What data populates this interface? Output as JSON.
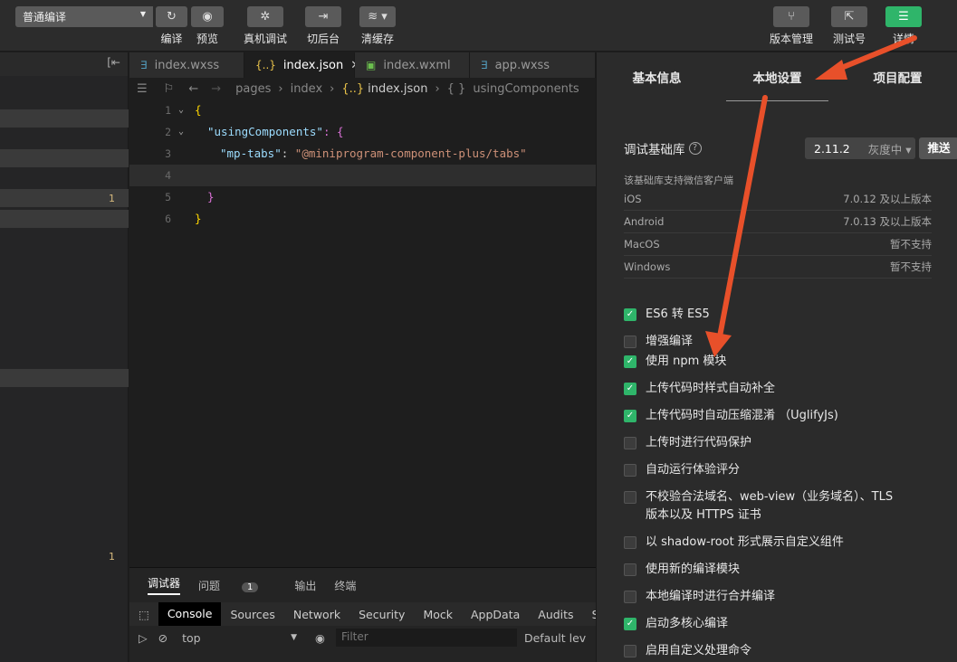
{
  "toolbar": {
    "compile_mode": "普通编译",
    "buttons": [
      {
        "label": "编译",
        "icon": "refresh-icon"
      },
      {
        "label": "预览",
        "icon": "eye-icon"
      },
      {
        "label": "真机调试",
        "icon": "bug-icon"
      },
      {
        "label": "切后台",
        "icon": "switch-icon"
      },
      {
        "label": "清缓存",
        "icon": "layers-icon"
      },
      {
        "label": "版本管理",
        "icon": "branch-icon"
      },
      {
        "label": "测试号",
        "icon": "share-icon"
      },
      {
        "label": "详情",
        "icon": "menu-icon"
      }
    ],
    "accent_color": "#2fb56a"
  },
  "left": {
    "numbers": [
      "1",
      "1"
    ]
  },
  "tabs": [
    {
      "label": "index.wxss",
      "icon": "css-icon"
    },
    {
      "label": "index.json",
      "icon": "json-icon",
      "active": true
    },
    {
      "label": "index.wxml",
      "icon": "wxml-icon"
    },
    {
      "label": "app.wxss",
      "icon": "css-icon"
    }
  ],
  "breadcrumb": {
    "p1": "pages",
    "p2": "index",
    "p3": "index.json",
    "p4": "usingComponents"
  },
  "editor": {
    "lines": [
      "1",
      "2",
      "3",
      "4",
      "5",
      "6"
    ],
    "l1": "{",
    "l2_key": "\"usingComponents\"",
    "l2_rest": ": {",
    "l3_key": "\"mp-tabs\"",
    "l3_colon": ": ",
    "l3_val": "\"@miniprogram-component-plus/tabs\"",
    "l5": "}",
    "l6": "}"
  },
  "debug": {
    "tabs": [
      "调试器",
      "问题",
      "输出",
      "终端"
    ],
    "problem_count": "1",
    "devtabs": [
      "Console",
      "Sources",
      "Network",
      "Security",
      "Mock",
      "AppData",
      "Audits",
      "S"
    ],
    "context": "top",
    "filter_placeholder": "Filter",
    "levels": "Default lev"
  },
  "right": {
    "tabs": [
      "基本信息",
      "本地设置",
      "项目配置"
    ],
    "lib_title": "调试基础库",
    "version": "2.11.2",
    "gray": "灰度中 ▾",
    "push": "推送",
    "support_note": "该基础库支持微信客户端",
    "platforms": [
      {
        "name": "iOS",
        "value": "7.0.12 及以上版本"
      },
      {
        "name": "Android",
        "value": "7.0.13 及以上版本"
      },
      {
        "name": "MacOS",
        "value": "暂不支持"
      },
      {
        "name": "Windows",
        "value": "暂不支持"
      }
    ],
    "options": [
      {
        "label": "ES6 转 ES5",
        "checked": true
      },
      {
        "label": "增强编译",
        "checked": false
      },
      {
        "label": "使用 npm 模块",
        "checked": true
      },
      {
        "label": "上传代码时样式自动补全",
        "checked": true
      },
      {
        "label": "上传代码时自动压缩混淆 （UglifyJs)",
        "checked": true
      },
      {
        "label": "上传时进行代码保护",
        "checked": false
      },
      {
        "label": "自动运行体验评分",
        "checked": false
      },
      {
        "label": "不校验合法域名、web-view（业务域名）、TLS 版本以及 HTTPS 证书",
        "checked": false
      },
      {
        "label": "以 shadow-root 形式展示自定义组件",
        "checked": false
      },
      {
        "label": "使用新的编译模块",
        "checked": false
      },
      {
        "label": "本地编译时进行合并编译",
        "checked": false
      },
      {
        "label": "启动多核心编译",
        "checked": true
      },
      {
        "label": "启用自定义处理命令",
        "checked": false
      }
    ]
  }
}
